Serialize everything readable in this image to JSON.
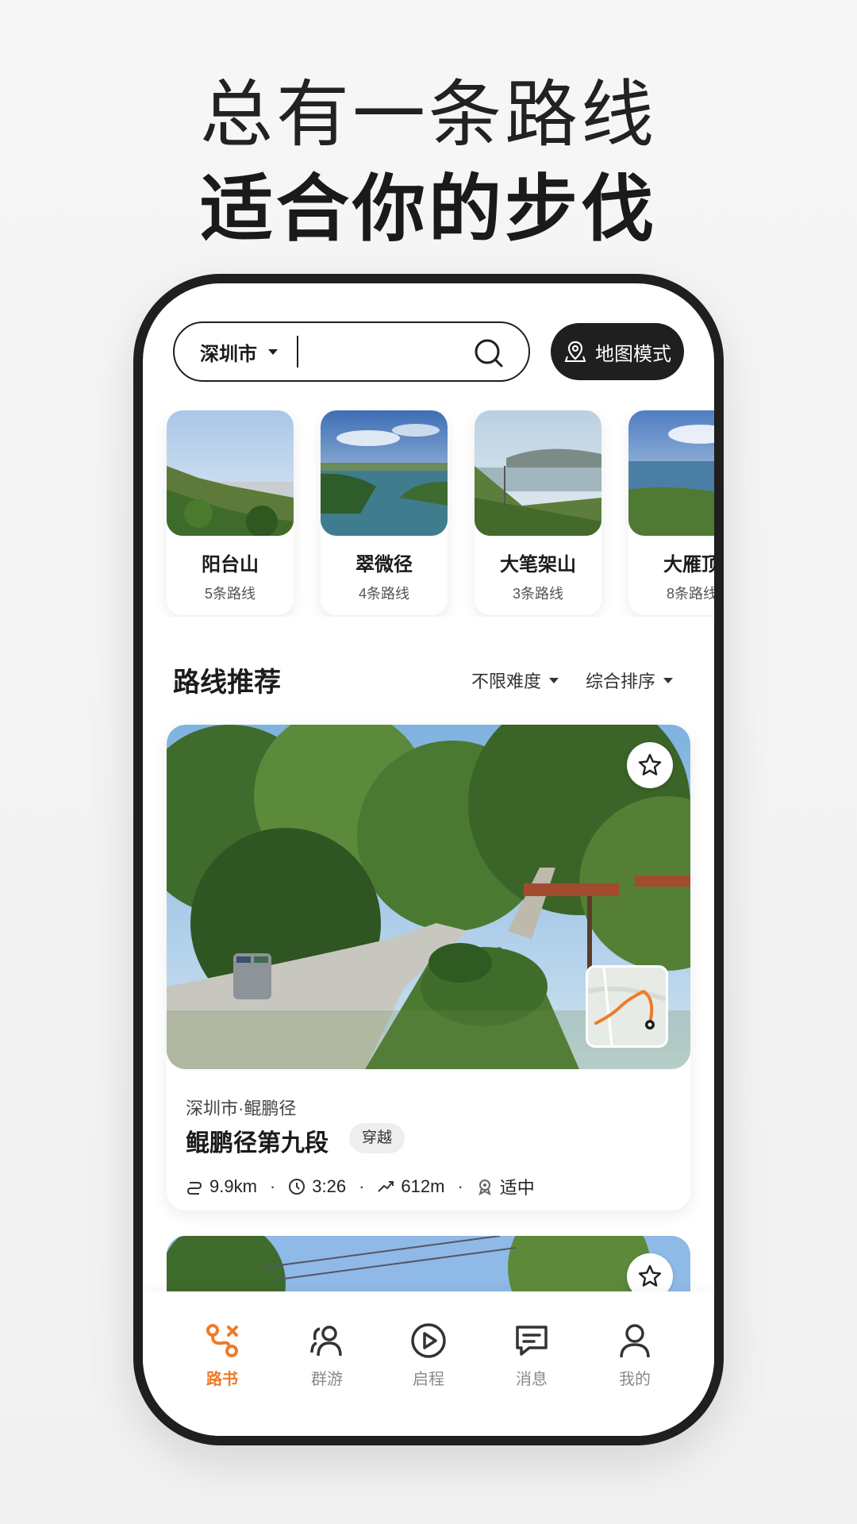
{
  "headline": {
    "line1": "总有一条路线",
    "line2": "适合你的步伐"
  },
  "search": {
    "city": "深圳市",
    "placeholder": ""
  },
  "map_mode_label": "地图模式",
  "places": [
    {
      "name": "阳台山",
      "count": "5条路线"
    },
    {
      "name": "翠微径",
      "count": "4条路线"
    },
    {
      "name": "大笔架山",
      "count": "3条路线"
    },
    {
      "name": "大雁顶",
      "count": "8条路线"
    }
  ],
  "section": {
    "title": "路线推荐",
    "filter_difficulty": "不限难度",
    "filter_sort": "综合排序"
  },
  "route": {
    "location": "深圳市·鲲鹏径",
    "title": "鲲鹏径第九段",
    "tag": "穿越",
    "distance": "9.9km",
    "duration": "3:26",
    "elevation": "612m",
    "difficulty": "适中"
  },
  "tabs": [
    {
      "label": "路书",
      "active": true
    },
    {
      "label": "群游",
      "active": false
    },
    {
      "label": "启程",
      "active": false
    },
    {
      "label": "消息",
      "active": false
    },
    {
      "label": "我的",
      "active": false
    }
  ],
  "colors": {
    "accent": "#ef7a2a",
    "dark": "#1f1f1f"
  }
}
